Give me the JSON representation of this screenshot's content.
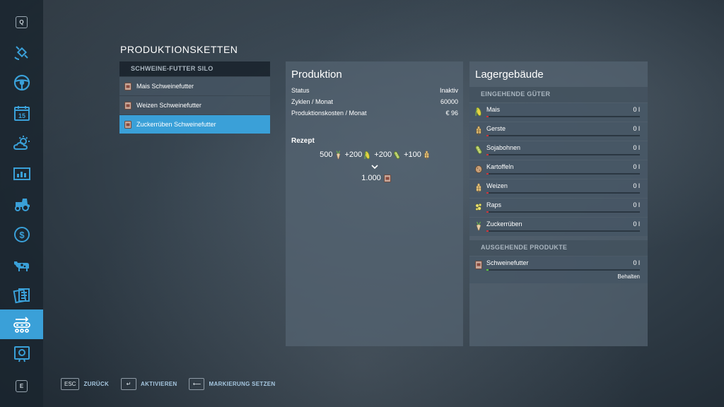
{
  "sidebar": {
    "top_key": "Q",
    "bottom_key": "E",
    "items": [
      {
        "icon": "satellite-icon"
      },
      {
        "icon": "steering-wheel-icon"
      },
      {
        "icon": "calendar-icon",
        "label": "15"
      },
      {
        "icon": "weather-icon"
      },
      {
        "icon": "statistics-icon"
      },
      {
        "icon": "tractor-icon"
      },
      {
        "icon": "dollar-icon"
      },
      {
        "icon": "cow-icon"
      },
      {
        "icon": "contracts-icon"
      },
      {
        "icon": "production-chain-icon",
        "active": true
      },
      {
        "icon": "help-icon"
      }
    ],
    "accent": "#3aa0d8"
  },
  "page": {
    "title": "PRODUKTIONSKETTEN"
  },
  "chains": {
    "header": "SCHWEINE-FUTTER SILO",
    "items": [
      {
        "label": "Mais Schweinefutter"
      },
      {
        "label": "Weizen Schweinefutter"
      },
      {
        "label": "Zuckerrüben Schweinefutter",
        "selected": true
      }
    ]
  },
  "production": {
    "title": "Produktion",
    "rows": [
      {
        "key": "Status",
        "value": "Inaktiv"
      },
      {
        "key": "Zyklen / Monat",
        "value": "60000"
      },
      {
        "key": "Produktionskosten / Monat",
        "value": "€ 96"
      }
    ],
    "recipe_label": "Rezept",
    "recipe_inputs": [
      {
        "amount": "500",
        "icon": "sugarbeet-icon"
      },
      {
        "amount": "+200",
        "icon": "corn-icon"
      },
      {
        "amount": "+200",
        "icon": "soybean-icon"
      },
      {
        "amount": "+100",
        "icon": "wheat-icon"
      }
    ],
    "recipe_output": {
      "amount": "1.000",
      "icon": "pig-feed-icon"
    }
  },
  "storage": {
    "title": "Lagergebäude",
    "incoming_header": "EINGEHENDE GÜTER",
    "incoming": [
      {
        "name": "Mais",
        "value": "0 l",
        "icon": "corn-icon"
      },
      {
        "name": "Gerste",
        "value": "0 l",
        "icon": "barley-icon"
      },
      {
        "name": "Sojabohnen",
        "value": "0 l",
        "icon": "soybean-icon"
      },
      {
        "name": "Kartoffeln",
        "value": "0 l",
        "icon": "potato-icon"
      },
      {
        "name": "Weizen",
        "value": "0 l",
        "icon": "wheat-icon"
      },
      {
        "name": "Raps",
        "value": "0 l",
        "icon": "canola-icon"
      },
      {
        "name": "Zuckerrüben",
        "value": "0 l",
        "icon": "sugarbeet-icon"
      }
    ],
    "outgoing_header": "AUSGEHENDE PRODUKTE",
    "outgoing": [
      {
        "name": "Schweinefutter",
        "value": "0 l",
        "mode": "Behalten",
        "icon": "pig-feed-icon"
      }
    ]
  },
  "hints": [
    {
      "key": "ESC",
      "label": "ZURÜCK"
    },
    {
      "key": "↵",
      "label": "AKTIVIEREN"
    },
    {
      "key": "⟵",
      "label": "MARKIERUNG SETZEN"
    }
  ]
}
